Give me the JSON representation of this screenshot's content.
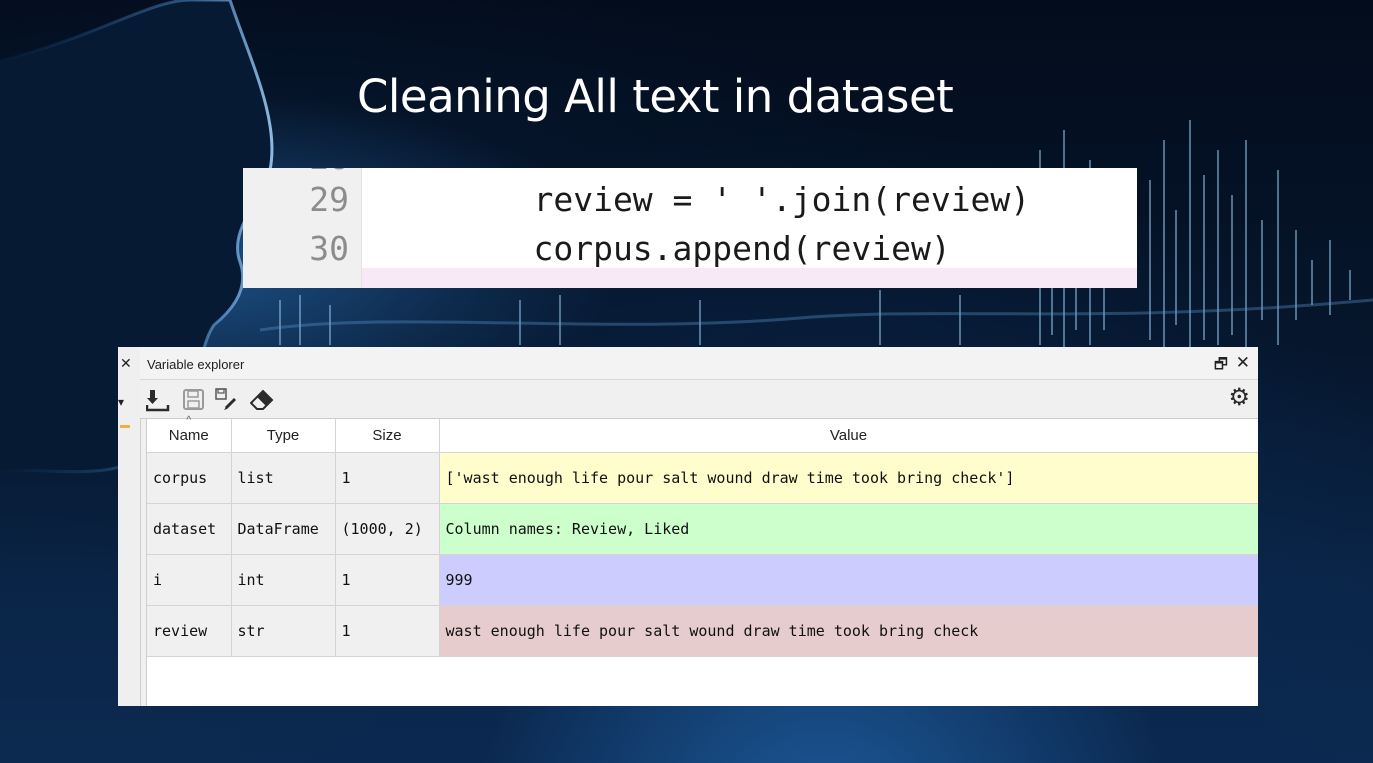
{
  "slide": {
    "title": "Cleaning All text in dataset"
  },
  "code": {
    "lines": [
      {
        "number": "29",
        "text": "    review = ' '.join(review)"
      },
      {
        "number": "30",
        "text": "    corpus.append(review)"
      }
    ]
  },
  "panel": {
    "title": "Variable explorer",
    "toolbar_icons": [
      "import-data-icon",
      "save-data-icon",
      "save-as-icon",
      "remove-all-variables-icon",
      "options-gear-icon"
    ],
    "columns": [
      "Name",
      "Type",
      "Size",
      "Value"
    ],
    "rows": [
      {
        "name": "corpus",
        "type": "list",
        "size": "1",
        "value": "['wast enough life pour salt wound draw time took bring check']",
        "color": "#fffdcc"
      },
      {
        "name": "dataset",
        "type": "DataFrame",
        "size": "(1000, 2)",
        "value": "Column names: Review, Liked",
        "color": "#ccffcc"
      },
      {
        "name": "i",
        "type": "int",
        "size": "1",
        "value": "999",
        "color": "#ccccff"
      },
      {
        "name": "review",
        "type": "str",
        "size": "1",
        "value": "wast enough life pour salt wound draw time took bring check",
        "color": "#e6cccc"
      }
    ]
  }
}
